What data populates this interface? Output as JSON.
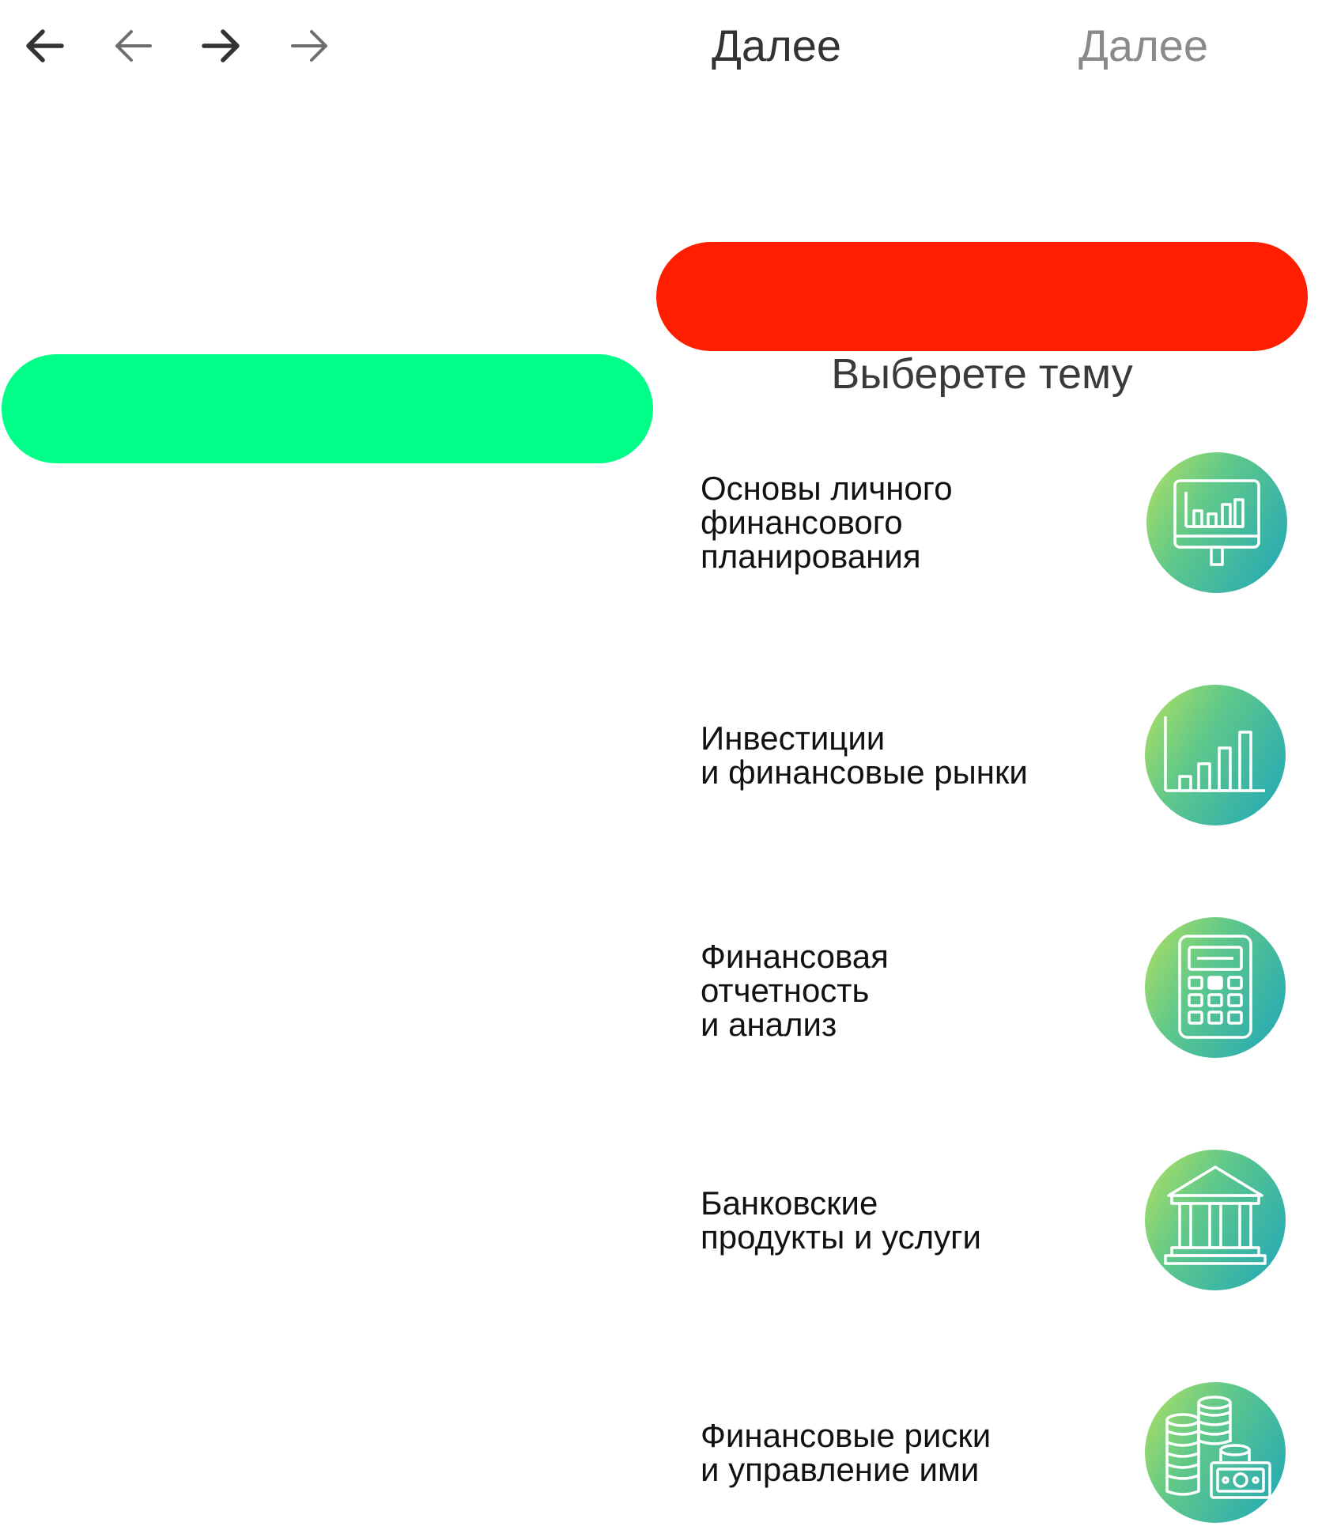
{
  "nav": {
    "arrows": [
      {
        "icon": "arrow-left-icon",
        "color": "#333333"
      },
      {
        "icon": "arrow-left-icon",
        "color": "#6e6e6e"
      },
      {
        "icon": "arrow-right-icon",
        "color": "#333333"
      },
      {
        "icon": "arrow-right-icon",
        "color": "#6e6e6e"
      }
    ],
    "next_primary": "Далее",
    "next_secondary": "Далее"
  },
  "buttons": {
    "red_color": "#ff1e00",
    "green_color": "#00ff88"
  },
  "title": "Выберете тему",
  "topics": [
    {
      "lines": [
        "Основы личного",
        "финансового",
        "планирования"
      ],
      "icon": "monitor-chart-icon"
    },
    {
      "lines": [
        "Инвестиции",
        "и финансовые рынки"
      ],
      "icon": "bar-chart-icon"
    },
    {
      "lines": [
        "Финансовая",
        "отчетность",
        "и анализ"
      ],
      "icon": "calculator-icon"
    },
    {
      "lines": [
        "Банковские",
        "продукты и услуги"
      ],
      "icon": "bank-icon"
    },
    {
      "lines": [
        "Финансовые риски",
        "и управление ими"
      ],
      "icon": "coins-money-icon"
    }
  ],
  "colors": {
    "icon_gradient_start": "#b4e161",
    "icon_gradient_end": "#1fa6ba"
  }
}
